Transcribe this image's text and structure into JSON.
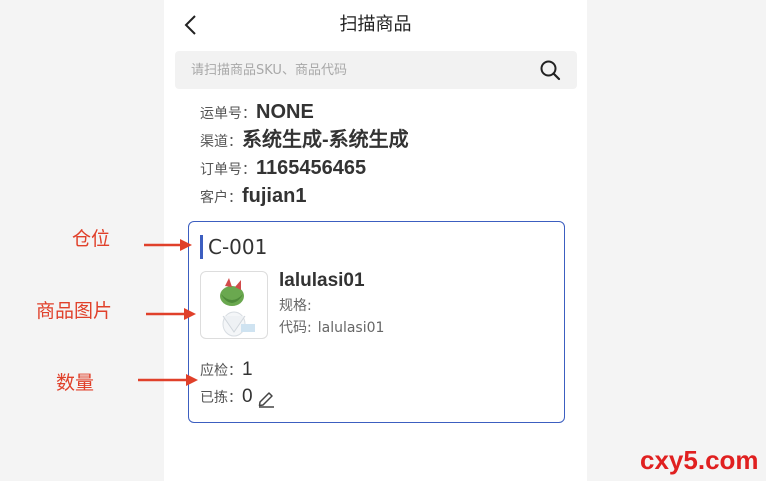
{
  "header": {
    "title": "扫描商品"
  },
  "search": {
    "placeholder": "请扫描商品SKU、商品代码"
  },
  "info": [
    {
      "label": "运单号：",
      "value": "NONE"
    },
    {
      "label": "渠道：",
      "value": "系统生成-系统生成"
    },
    {
      "label": "订单号：",
      "value": "1165456465"
    },
    {
      "label": "客户：",
      "value": "fujian1"
    }
  ],
  "card": {
    "location": "C-001",
    "product_name": "lalulasi01",
    "spec_label": "规格:",
    "spec_value": "",
    "code_label": "代码:",
    "code_value": "lalulasi01",
    "expected_label": "应检：",
    "expected_value": "1",
    "picked_label": "已拣：",
    "picked_value": "0"
  },
  "annotations": {
    "location": "仓位",
    "image": "商品图片",
    "quantity": "数量"
  },
  "watermark": "cxy5.com",
  "colors": {
    "accent": "#3c5ec0",
    "annotation": "#e0402a",
    "watermark": "#e02020"
  },
  "icons": {
    "back": "chevron-left-icon",
    "search": "search-icon",
    "edit": "pencil-icon"
  }
}
